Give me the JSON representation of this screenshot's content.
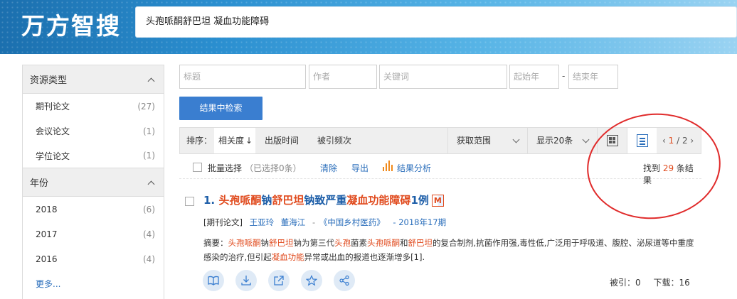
{
  "header": {
    "logo": "万方智搜",
    "search_query": "头孢哌酮舒巴坦 凝血功能障碍"
  },
  "sidebar": {
    "sections": [
      {
        "title": "资源类型",
        "items": [
          {
            "label": "期刊论文",
            "count": "(27)"
          },
          {
            "label": "会议论文",
            "count": "(1)"
          },
          {
            "label": "学位论文",
            "count": "(1)"
          }
        ]
      },
      {
        "title": "年份",
        "items": [
          {
            "label": "2018",
            "count": "(6)"
          },
          {
            "label": "2017",
            "count": "(4)"
          },
          {
            "label": "2016",
            "count": "(4)"
          }
        ]
      }
    ],
    "more": "更多..."
  },
  "filters": {
    "title_ph": "标题",
    "author_ph": "作者",
    "keyword_ph": "关键词",
    "start_year_ph": "起始年",
    "end_year_ph": "结束年",
    "dash": "-",
    "search_button": "结果中检索"
  },
  "sortbar": {
    "label": "排序：",
    "relevance": "相关度",
    "relevance_arrow": "↓",
    "pub_time": "出版时间",
    "citations": "被引频次",
    "range": "获取范围",
    "per_page": "显示20条",
    "pager": {
      "prev": "‹",
      "current": "1",
      "sep": " / ",
      "total": "2",
      "next": "›"
    }
  },
  "actions": {
    "batch": "批量选择",
    "selected": "（已选择0条）",
    "clear": "清除",
    "export": "导出",
    "analysis": "结果分析",
    "found_prefix": "找到 ",
    "found_count": "29",
    "found_suffix": " 条结果"
  },
  "result": {
    "number": "1.",
    "title_parts": [
      {
        "text": " 头孢哌酮",
        "hl": true
      },
      {
        "text": "钠",
        "hl": false
      },
      {
        "text": "舒巴坦",
        "hl": true
      },
      {
        "text": "钠致严重",
        "hl": false
      },
      {
        "text": "凝血功能障碍",
        "hl": true
      },
      {
        "text": "1例",
        "hl": false
      }
    ],
    "badge": "M",
    "type_tag": "[期刊论文]",
    "authors": [
      "王亚玲",
      "董海江"
    ],
    "journal_sep": "-",
    "journal": "《中国乡村医药》",
    "issue": "- 2018年17期",
    "abstract_label": "摘要：",
    "abstract_parts": [
      {
        "text": "头孢哌酮",
        "hl": true
      },
      {
        "text": "钠",
        "hl": false
      },
      {
        "text": "舒巴坦",
        "hl": true
      },
      {
        "text": "钠为第三代",
        "hl": false
      },
      {
        "text": "头孢",
        "hl": true
      },
      {
        "text": "菌素",
        "hl": false
      },
      {
        "text": "头孢哌酮",
        "hl": true
      },
      {
        "text": "和",
        "hl": false
      },
      {
        "text": "舒巴坦",
        "hl": true
      },
      {
        "text": "的复合制剂,抗菌作用强,毒性低,广泛用于呼吸道、腹腔、泌尿道等中重度感染的治疗,但引起",
        "hl": false
      },
      {
        "text": "凝血功能",
        "hl": true
      },
      {
        "text": "异常或出血的报道也逐渐增多[1].",
        "hl": false
      }
    ],
    "cited": "被引：0",
    "downloads": "下载：16",
    "tools": [
      "book-icon",
      "download-icon",
      "external-link-icon",
      "star-icon",
      "share-icon"
    ]
  },
  "colors": {
    "accent": "#3a7ed0",
    "highlight": "#e04a1d",
    "annotation": "#e02b2b"
  }
}
